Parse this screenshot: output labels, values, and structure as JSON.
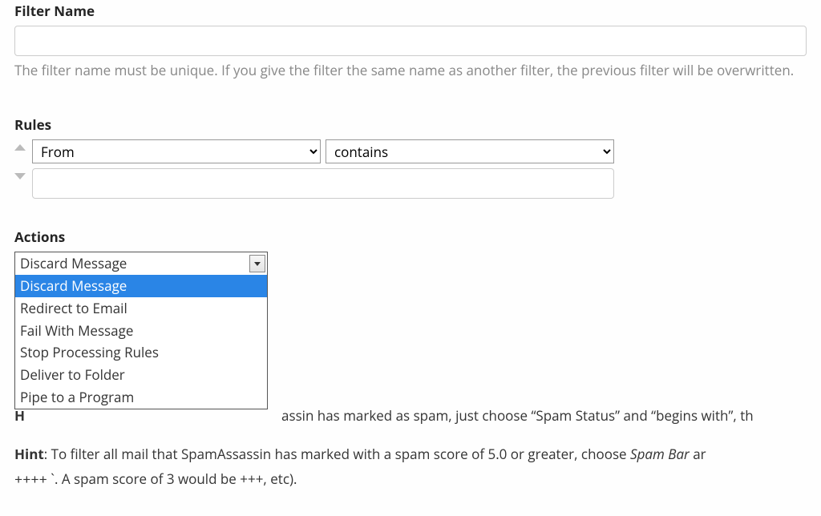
{
  "filter_name": {
    "label": "Filter Name",
    "value": "",
    "help": "The filter name must be unique. If you give the filter the same name as another filter, the previous filter will be overwritten."
  },
  "rules": {
    "label": "Rules",
    "field_selected": "From",
    "condition_selected": "contains",
    "value": ""
  },
  "actions": {
    "label": "Actions",
    "selected": "Discard Message",
    "options": [
      "Discard Message",
      "Redirect to Email",
      "Fail With Message",
      "Stop Processing Rules",
      "Deliver to Folder",
      "Pipe to a Program"
    ]
  },
  "hint1": {
    "prefix": "H",
    "after": "assin has marked as spam, just choose “Spam Status” and “begins with”, th"
  },
  "hint2": {
    "bold": "Hint",
    "mid": ": To filter all mail that SpamAssassin has marked with a spam score of 5.0 or greater, choose ",
    "ital": "Spam Bar",
    "tail1": " ar",
    "line2a": "++++",
    "line2b": " `. A spam score of 3 would be +++, etc)."
  }
}
